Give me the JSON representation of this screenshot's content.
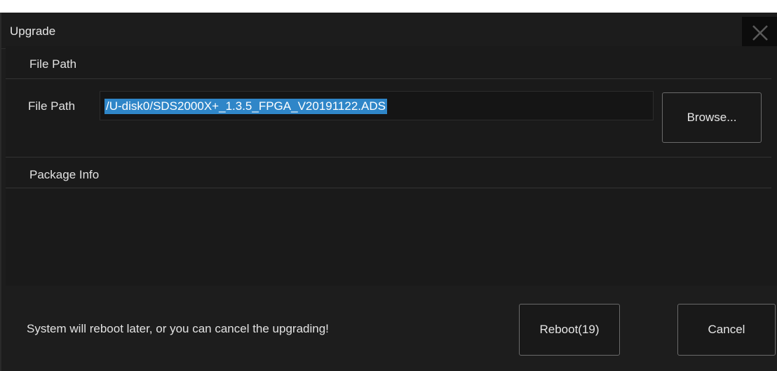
{
  "dialog": {
    "title": "Upgrade",
    "close_icon": "close-icon"
  },
  "file_path_section": {
    "heading": "File Path",
    "field_label": "File Path",
    "field_value": "/U-disk0/SDS2000X+_1.3.5_FPGA_V20191122.ADS",
    "browse_label": "Browse..."
  },
  "package_info": {
    "heading": "Package Info"
  },
  "footer": {
    "message": "System will reboot later, or you can cancel the upgrading!",
    "reboot_label": "Reboot(19)",
    "cancel_label": "Cancel"
  },
  "colors": {
    "background": "#1d1d1d",
    "selection": "#2f86c8",
    "text": "#e2e2e2"
  }
}
